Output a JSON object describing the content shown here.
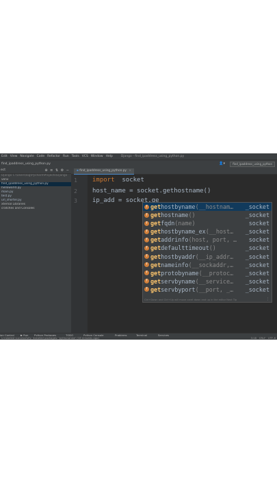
{
  "menubar": {
    "items": [
      "Edit",
      "View",
      "Navigate",
      "Code",
      "Refactor",
      "Run",
      "Tools",
      "VCS",
      "Window",
      "Help"
    ],
    "title": "Django - find_ipaddress_using_python.py"
  },
  "navbar": {
    "breadcrumb": "find_ipaddress_using_python.py",
    "run_config": "find_ipaddress_using_python"
  },
  "project_panel": {
    "header": "ect",
    "tree": [
      {
        "label": "Django  C:\\Users\\log\\PycharmProjects\\Django",
        "style": "dim"
      },
      {
        "label": "venv",
        "style": "normal"
      },
      {
        "label": "find_ipaddress_using_python.py",
        "style": "sel"
      },
      {
        "label": "helloworld.py",
        "style": "py"
      },
      {
        "label": "main.py",
        "style": "py"
      },
      {
        "label": "test.py",
        "style": "py"
      },
      {
        "label": "url_shorter.py",
        "style": "py"
      },
      {
        "label": "xternal Libraries",
        "style": "normal"
      },
      {
        "label": "cratches and Consoles",
        "style": "normal"
      }
    ]
  },
  "editor": {
    "tab": "find_ipaddress_using_python.py",
    "lines": [
      {
        "num": "1",
        "parts": [
          {
            "t": "import",
            "kw": true
          },
          {
            "t": "  socket",
            "kw": false
          }
        ]
      },
      {
        "num": "2",
        "parts": [
          {
            "t": "host_name = socket.gethostname()",
            "kw": false
          }
        ]
      },
      {
        "num": "3",
        "parts": [
          {
            "t": "ip_add = socket.ge",
            "kw": false
          }
        ]
      }
    ]
  },
  "completion": {
    "items": [
      {
        "hl": "get",
        "rest": "hostbyname",
        "params": "(__hostnam…",
        "module": "_socket",
        "selected": true
      },
      {
        "hl": "get",
        "rest": "hostname",
        "params": "()",
        "module": "_socket",
        "selected": false
      },
      {
        "hl": "get",
        "rest": "fqdn",
        "params": "(name)",
        "module": "socket",
        "selected": false
      },
      {
        "hl": "get",
        "rest": "hostbyname_ex",
        "params": "(__host…",
        "module": "_socket",
        "selected": false
      },
      {
        "hl": "get",
        "rest": "addrinfo",
        "params": "(host, port, …",
        "module": "socket",
        "selected": false
      },
      {
        "hl": "get",
        "rest": "defaulttimeout",
        "params": "()",
        "module": "_socket",
        "selected": false
      },
      {
        "hl": "get",
        "rest": "hostbyaddr",
        "params": "(__ip_addr…",
        "module": "_socket",
        "selected": false
      },
      {
        "hl": "get",
        "rest": "nameinfo",
        "params": "(__sockaddr,…",
        "module": "_socket",
        "selected": false
      },
      {
        "hl": "get",
        "rest": "protobyname",
        "params": "(__protoc…",
        "module": "_socket",
        "selected": false
      },
      {
        "hl": "get",
        "rest": "servbyname",
        "params": "(__service…",
        "module": "_socket",
        "selected": false
      },
      {
        "hl": "get",
        "rest": "servbyport",
        "params": "(__port, _…",
        "module": "_socket",
        "selected": false
      }
    ],
    "footer": "Ctrl+Down and Ctrl+Up will move caret down and up in the editor  Next Tip",
    "more": "⋮"
  },
  "toolbar": {
    "items": [
      "ion Control",
      "▶ Run",
      "Python Packages",
      "TODO",
      "Python Console",
      "Problems",
      "Terminal",
      "Services"
    ]
  },
  "status": {
    "message": "s installed successfully: Installed packages: 'pythonanew' (18 minutes ago)",
    "position": "3:18",
    "line_sep": "CRLF",
    "encoding": "UTF-8"
  }
}
